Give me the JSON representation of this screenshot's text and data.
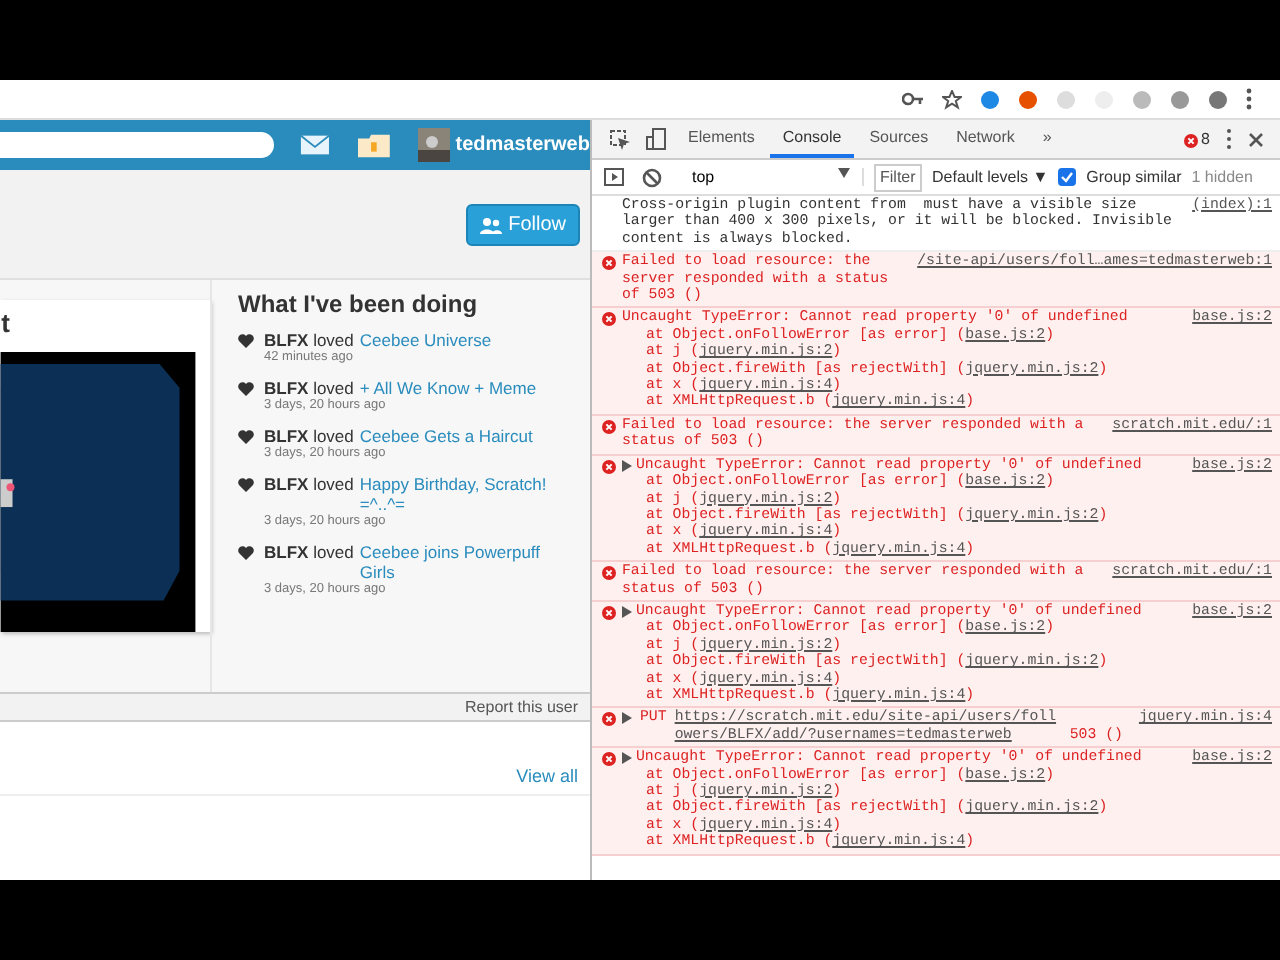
{
  "site": {
    "nav": {
      "username": "tedmasterweb"
    },
    "follow_button": "Follow",
    "card_heading": "t",
    "activity": {
      "title": "What I've been doing",
      "items": [
        {
          "user": "BLFX",
          "verb": "loved",
          "project": "Ceebee Universe",
          "time": "42 minutes ago"
        },
        {
          "user": "BLFX",
          "verb": "loved",
          "project": "+ All We Know + Meme",
          "time": "3 days, 20 hours ago"
        },
        {
          "user": "BLFX",
          "verb": "loved",
          "project": "Ceebee Gets a Haircut",
          "time": "3 days, 20 hours ago"
        },
        {
          "user": "BLFX",
          "verb": "loved",
          "project": "Happy Birthday, Scratch! =^..^=",
          "time": "3 days, 20 hours ago"
        },
        {
          "user": "BLFX",
          "verb": "loved",
          "project": "Ceebee joins Powerpuff Girls",
          "time": "3 days, 20 hours ago"
        }
      ]
    },
    "report_link": "Report this user",
    "view_all": "View all"
  },
  "devtools": {
    "tabs": [
      {
        "label": "Elements",
        "selected": false
      },
      {
        "label": "Console",
        "selected": true
      },
      {
        "label": "Sources",
        "selected": false
      },
      {
        "label": "Network",
        "selected": false
      }
    ],
    "more_tabs": "»",
    "error_count": "8",
    "toolbar": {
      "context": "top",
      "filter_placeholder": "Filter",
      "levels": "Default levels ▼",
      "group_similar": {
        "label": "Group similar",
        "checked": true
      },
      "hidden": "1 hidden"
    },
    "messages": [
      {
        "kind": "info",
        "text": "Cross-origin plugin content from  must have a visible size larger than 400 x 300 pixels, or it will be blocked. Invisible content is always blocked.",
        "source": "(index):1"
      },
      {
        "kind": "error",
        "expandable": false,
        "text": "Failed to load resource: the server responded with a status of 503 ()",
        "source": "/site-api/users/foll…ames=tedmasterweb:1"
      },
      {
        "kind": "error",
        "expandable": false,
        "text": "Uncaught TypeError: Cannot read property '0' of undefined",
        "source": "base.js:2",
        "stack": [
          {
            "prefix": "at Object.onFollowError [as error] (",
            "link": "base.js:2",
            "suffix": ")"
          },
          {
            "prefix": "at j (",
            "link": "jquery.min.js:2",
            "suffix": ")"
          },
          {
            "prefix": "at Object.fireWith [as rejectWith] (",
            "link": "jquery.min.js:2",
            "suffix": ")"
          },
          {
            "prefix": "at x (",
            "link": "jquery.min.js:4",
            "suffix": ")"
          },
          {
            "prefix": "at XMLHttpRequest.b (",
            "link": "jquery.min.js:4",
            "suffix": ")"
          }
        ]
      },
      {
        "kind": "error",
        "expandable": false,
        "text": "Failed to load resource: the server responded with a status of 503 ()",
        "source": "scratch.mit.edu/:1"
      },
      {
        "kind": "error",
        "expandable": true,
        "text": "Uncaught TypeError: Cannot read property '0' of undefined",
        "source": "base.js:2",
        "stack": [
          {
            "prefix": "at Object.onFollowError [as error] (",
            "link": "base.js:2",
            "suffix": ")"
          },
          {
            "prefix": "at j (",
            "link": "jquery.min.js:2",
            "suffix": ")"
          },
          {
            "prefix": "at Object.fireWith [as rejectWith] (",
            "link": "jquery.min.js:2",
            "suffix": ")"
          },
          {
            "prefix": "at x (",
            "link": "jquery.min.js:4",
            "suffix": ")"
          },
          {
            "prefix": "at XMLHttpRequest.b (",
            "link": "jquery.min.js:4",
            "suffix": ")"
          }
        ]
      },
      {
        "kind": "error",
        "expandable": false,
        "text": "Failed to load resource: the server responded with a status of 503 ()",
        "source": "scratch.mit.edu/:1"
      },
      {
        "kind": "error",
        "expandable": true,
        "text": "Uncaught TypeError: Cannot read property '0' of undefined",
        "source": "base.js:2",
        "stack": [
          {
            "prefix": "at Object.onFollowError [as error] (",
            "link": "base.js:2",
            "suffix": ")"
          },
          {
            "prefix": "at j (",
            "link": "jquery.min.js:2",
            "suffix": ")"
          },
          {
            "prefix": "at Object.fireWith [as rejectWith] (",
            "link": "jquery.min.js:2",
            "suffix": ")"
          },
          {
            "prefix": "at x (",
            "link": "jquery.min.js:4",
            "suffix": ")"
          },
          {
            "prefix": "at XMLHttpRequest.b (",
            "link": "jquery.min.js:4",
            "suffix": ")"
          }
        ]
      },
      {
        "kind": "request",
        "expandable": true,
        "method": "PUT",
        "url": "https://scratch.mit.edu/site-api/users/followers/BLFX/add/?usernames=tedmasterweb",
        "status": "503 ()",
        "source": "jquery.min.js:4"
      },
      {
        "kind": "error",
        "expandable": true,
        "text": "Uncaught TypeError: Cannot read property '0' of undefined",
        "source": "base.js:2",
        "stack": [
          {
            "prefix": "at Object.onFollowError [as error] (",
            "link": "base.js:2",
            "suffix": ")"
          },
          {
            "prefix": "at j (",
            "link": "jquery.min.js:2",
            "suffix": ")"
          },
          {
            "prefix": "at Object.fireWith [as rejectWith] (",
            "link": "jquery.min.js:2",
            "suffix": ")"
          },
          {
            "prefix": "at x (",
            "link": "jquery.min.js:4",
            "suffix": ")"
          },
          {
            "prefix": "at XMLHttpRequest.b (",
            "link": "jquery.min.js:4",
            "suffix": ")"
          }
        ]
      }
    ]
  }
}
